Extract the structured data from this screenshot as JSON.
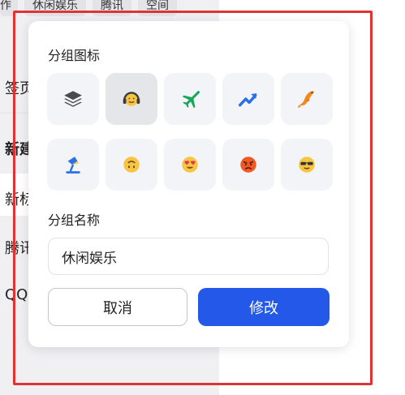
{
  "background": {
    "tabs": [
      "作",
      "休闲娱乐",
      "腾讯",
      "空间"
    ],
    "side_texts": [
      "签页",
      "新建",
      "新标",
      "腾讯",
      "QQ"
    ]
  },
  "dialog": {
    "icon_section_title": "分组图标",
    "icons": [
      "layers-icon",
      "headset-emoji-icon",
      "airplane-icon",
      "trend-up-icon",
      "koi-fish-icon",
      "desk-lamp-icon",
      "upside-down-face-icon",
      "heart-eyes-face-icon",
      "angry-face-icon",
      "sunglasses-face-icon"
    ],
    "selected_icon": "headset-emoji-icon",
    "name_section_title": "分组名称",
    "name_value": "休闲娱乐",
    "cancel_label": "取消",
    "confirm_label": "修改",
    "colors": {
      "primary": "#2358e8",
      "highlight": "#e03434"
    }
  }
}
